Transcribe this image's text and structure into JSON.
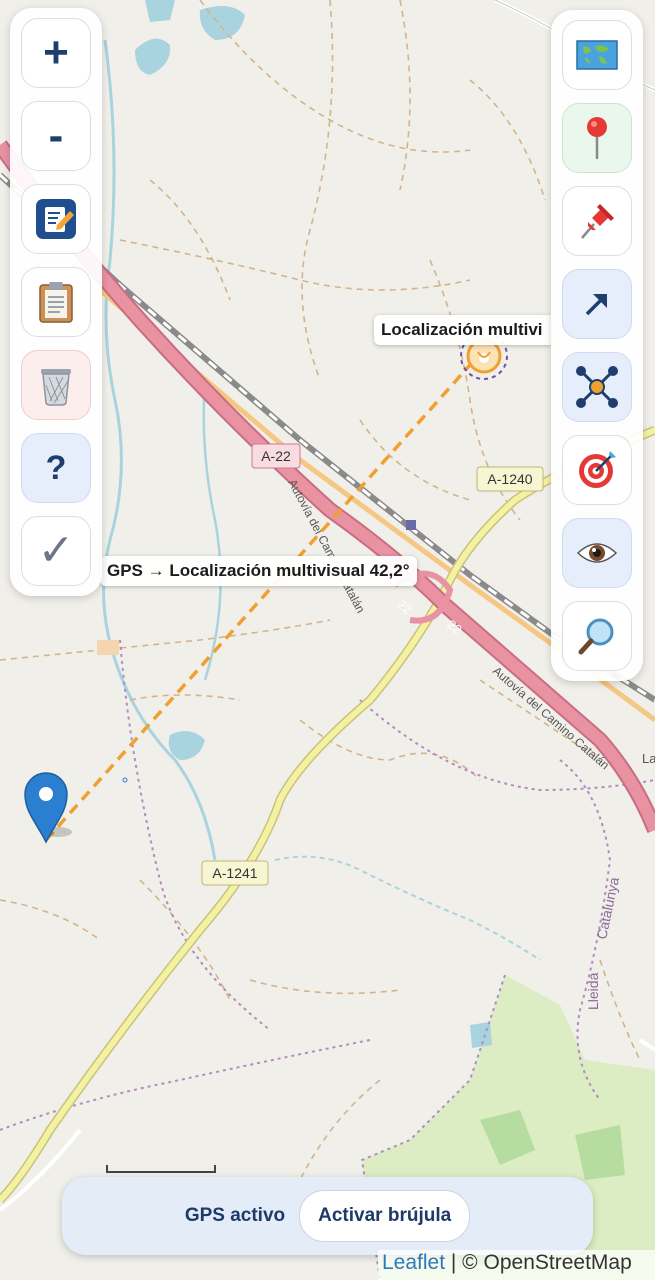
{
  "map": {
    "road_labels": [
      "A-22",
      "A-1240",
      "A-1241",
      "22",
      "22"
    ],
    "motorway_name": "Autovía del Camino Catalán",
    "region_labels": [
      "Catalunya",
      "Lleida",
      "La"
    ],
    "bearing_label": "GPS → Localización multivisual 42,2°",
    "target_label": "Localización multivi",
    "colors": {
      "background": "#f1efe9",
      "motorway": "#e892a2",
      "trunk": "#f4f1a3",
      "water": "#a9d3df",
      "bearing_line": "#f0a030",
      "gps_marker": "#2b7fd0"
    }
  },
  "left_toolbar": [
    {
      "name": "zoom-in-button",
      "glyph": "+",
      "icon": "plus-icon"
    },
    {
      "name": "zoom-out-button",
      "glyph": "-",
      "icon": "minus-icon"
    },
    {
      "name": "edit-button",
      "icon": "edit-icon"
    },
    {
      "name": "clipboard-button",
      "icon": "clipboard-icon"
    },
    {
      "name": "delete-button",
      "icon": "trash-icon"
    },
    {
      "name": "help-button",
      "glyph": "?",
      "icon": "question-icon"
    },
    {
      "name": "confirm-button",
      "glyph": "✓",
      "icon": "check-icon"
    }
  ],
  "right_toolbar": [
    {
      "name": "map-layers-button",
      "icon": "world-map-icon"
    },
    {
      "name": "add-marker-button",
      "icon": "round-pushpin-icon"
    },
    {
      "name": "pin-button",
      "icon": "pushpin-icon"
    },
    {
      "name": "direction-button",
      "icon": "arrow-icon"
    },
    {
      "name": "triangulation-button",
      "icon": "network-icon"
    },
    {
      "name": "target-button",
      "icon": "bullseye-icon"
    },
    {
      "name": "visibility-button",
      "icon": "eye-icon"
    },
    {
      "name": "search-button",
      "icon": "magnifier-icon"
    }
  ],
  "bottom_bar": {
    "gps_status": "GPS activo",
    "compass_button": "Activar brújula"
  },
  "attribution": {
    "leaflet": "Leaflet",
    "separator": " | © ",
    "osm": "OpenStreetMap"
  }
}
